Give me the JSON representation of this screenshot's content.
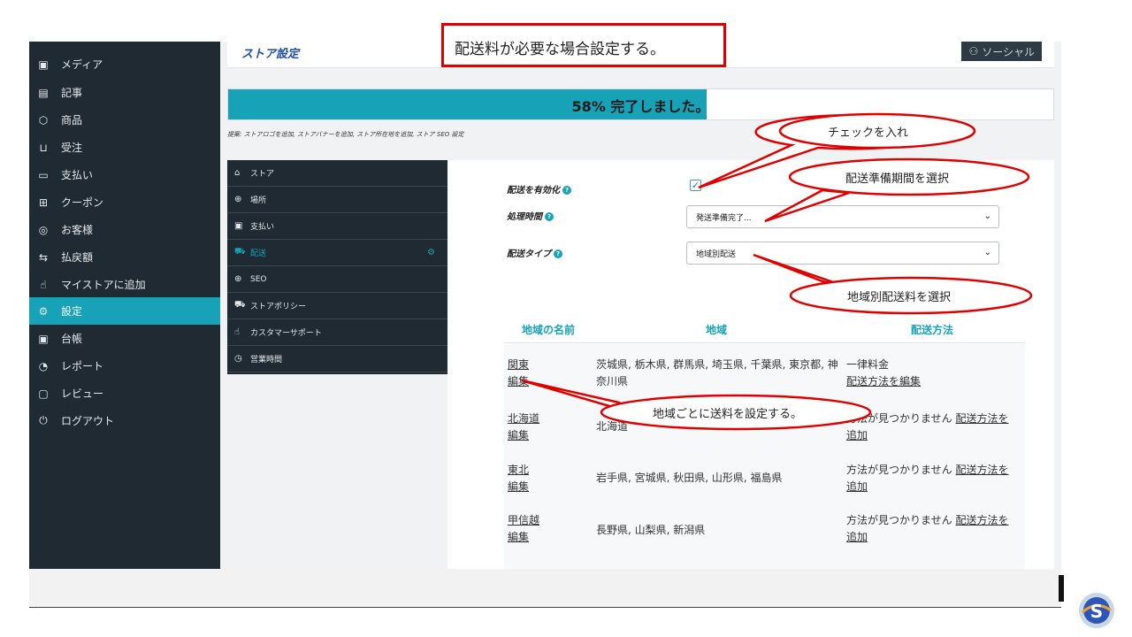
{
  "sidebar": {
    "items": [
      {
        "label": "メディア",
        "icon": "image-icon"
      },
      {
        "label": "記事",
        "icon": "document-icon"
      },
      {
        "label": "商品",
        "icon": "box-icon"
      },
      {
        "label": "受注",
        "icon": "cart-icon"
      },
      {
        "label": "支払い",
        "icon": "card-icon"
      },
      {
        "label": "クーポン",
        "icon": "gift-icon"
      },
      {
        "label": "お客様",
        "icon": "user-icon"
      },
      {
        "label": "払戻額",
        "icon": "refund-icon"
      },
      {
        "label": "マイストアに追加",
        "icon": "hand-icon"
      },
      {
        "label": "設定",
        "icon": "settings-icon"
      },
      {
        "label": "台帳",
        "icon": "money-icon"
      },
      {
        "label": "レポート",
        "icon": "chart-icon"
      },
      {
        "label": "レビュー",
        "icon": "comment-icon"
      },
      {
        "label": "ログアウト",
        "icon": "power-icon"
      }
    ]
  },
  "header": {
    "title": "ストア設定",
    "social_label": "ソーシャル"
  },
  "progress": {
    "percent": 58,
    "label_pct": "58%",
    "label_text": "完了しました。"
  },
  "suggestion": "提案: ストアロゴを追加, ストアバナーを追加, ストア所在地を追加, ストア SEO 設定",
  "submenu": {
    "items": [
      {
        "label": "ストア",
        "icon": "bag-icon"
      },
      {
        "label": "場所",
        "icon": "globe-icon"
      },
      {
        "label": "支払い",
        "icon": "money-icon"
      },
      {
        "label": "配送",
        "icon": "truck-icon"
      },
      {
        "label": "SEO",
        "icon": "globe-icon"
      },
      {
        "label": "ストアポリシー",
        "icon": "policy-icon"
      },
      {
        "label": "カスタマーサポート",
        "icon": "thumbs-up-icon"
      },
      {
        "label": "営業時間",
        "icon": "clock-icon"
      }
    ]
  },
  "form": {
    "enable_label": "配送を有効化",
    "processing_label": "処理時間",
    "processing_value": "発送準備完了...",
    "type_label": "配送タイプ",
    "type_value": "地域別配送"
  },
  "table": {
    "headers": [
      "地域の名前",
      "地域",
      "配送方法"
    ],
    "rows": [
      {
        "name": "関東",
        "edit": "編集",
        "regions": "茨城県, 栃木県, 群馬県, 埼玉県, 千葉県, 東京都, 神奈川県",
        "method": "一律料金",
        "method_link": "配送方法を編集"
      },
      {
        "name": "北海道",
        "edit": "編集",
        "regions": "北海道",
        "method": "方法が見つかりません",
        "method_link": "配送方法を追加"
      },
      {
        "name": "東北",
        "edit": "編集",
        "regions": "岩手県, 宮城県, 秋田県, 山形県, 福島県",
        "method": "方法が見つかりません",
        "method_link": "配送方法を追加"
      },
      {
        "name": "甲信越",
        "edit": "編集",
        "regions": "長野県, 山梨県, 新潟県",
        "method": "方法が見つかりません",
        "method_link": "配送方法を追加"
      }
    ]
  },
  "annotations": {
    "top_box": "配送料が必要な場合設定する。",
    "check": "チェックを入れ",
    "prep": "配送準備期間を選択",
    "region_rate": "地域別配送料を選択",
    "per_region": "地域ごとに送料を設定する。"
  },
  "colors": {
    "accent": "#17a2b8",
    "sidebar": "#1f2a33",
    "annotation": "#e00000"
  }
}
